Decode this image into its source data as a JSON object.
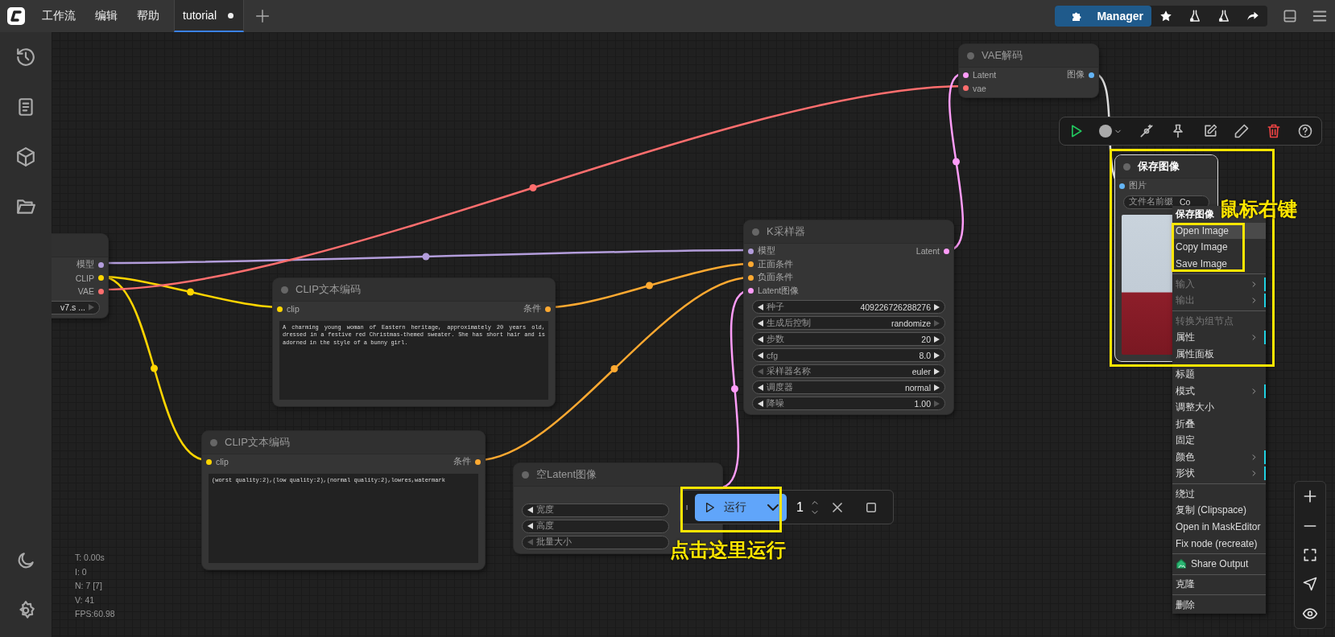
{
  "menus": [
    {
      "label": "工作流"
    },
    {
      "label": "编辑"
    },
    {
      "label": "帮助"
    }
  ],
  "tabs": [
    {
      "label": "tutorial",
      "selected": true,
      "unsaved": true
    }
  ],
  "manager": {
    "label": "Manager"
  },
  "nodes": [
    {
      "kind": "checkpoint",
      "outputs": [
        {
          "label": "模型",
          "color": "#b39ddb"
        },
        {
          "label": "CLIP",
          "color": "#ffd500"
        },
        {
          "label": "VAE",
          "color": "#ff6e6e"
        }
      ],
      "widgets": [
        {
          "kind": "combo",
          "value": "v7.s ...",
          "right_disabled": true
        }
      ]
    },
    {
      "kind": "clip_text",
      "title": "CLIP文本编码",
      "inputs": [
        {
          "label": "clip",
          "color": "#ffd500"
        }
      ],
      "outputs": [
        {
          "label": "条件",
          "color": "#ffa931"
        }
      ],
      "text": "(worst quality:2),(low quality:2),(normal quality:2),lowres,watermark"
    },
    {
      "kind": "clip_text",
      "title": "CLIP文本编码",
      "inputs": [
        {
          "label": "clip",
          "color": "#ffd500"
        }
      ],
      "outputs": [
        {
          "label": "条件",
          "color": "#ffa931"
        }
      ],
      "text": "A charming young woman of Eastern heritage, approximately 20 years old, dressed in a festive red Christmas-themed sweater. She has short hair and is adorned in the style of a bunny girl."
    },
    {
      "kind": "empty_latent",
      "title": "空Latent图像",
      "widgets": [
        {
          "kind": "number",
          "label": "宽度",
          "left_disabled": false
        },
        {
          "kind": "number",
          "label": "高度",
          "left_disabled": false
        },
        {
          "kind": "number",
          "label": "批量大小",
          "left_disabled": true
        }
      ]
    },
    {
      "kind": "ksampler",
      "title": "K采样器",
      "inputs": [
        {
          "label": "模型",
          "color": "#b39ddb"
        },
        {
          "label": "正面条件",
          "color": "#ffa931"
        },
        {
          "label": "负面条件",
          "color": "#ffa931"
        },
        {
          "label": "Latent图像",
          "color": "#ff9cf9"
        }
      ],
      "outputs": [
        {
          "label": "Latent",
          "color": "#ff9cf9"
        }
      ],
      "widgets": [
        {
          "kind": "number",
          "label": "种子",
          "value": "409226726288276",
          "left_disabled": false,
          "right_disabled": false
        },
        {
          "kind": "combo",
          "label": "生成后控制",
          "value": "randomize",
          "left_disabled": false,
          "right_disabled": true
        },
        {
          "kind": "number",
          "label": "步数",
          "value": "20",
          "left_disabled": false,
          "right_disabled": false
        },
        {
          "kind": "number",
          "label": "cfg",
          "value": "8.0",
          "left_disabled": false,
          "right_disabled": false
        },
        {
          "kind": "combo",
          "label": "采样器名称",
          "value": "euler",
          "left_disabled": true,
          "right_disabled": false
        },
        {
          "kind": "combo",
          "label": "调度器",
          "value": "normal",
          "left_disabled": false,
          "right_disabled": false
        },
        {
          "kind": "number",
          "label": "降噪",
          "value": "1.00",
          "left_disabled": false,
          "right_disabled": true
        }
      ]
    },
    {
      "kind": "vae_decode",
      "title": "VAE解码",
      "inputs": [
        {
          "label": "Latent",
          "color": "#ff9cf9"
        },
        {
          "label": "vae",
          "color": "#ff6e6e"
        }
      ],
      "outputs": [
        {
          "label": "图像",
          "color": "#64b5f6"
        }
      ]
    },
    {
      "kind": "save_image",
      "title": "保存图像",
      "inputs": [
        {
          "label": "图片",
          "color": "#64b5f6"
        }
      ],
      "widgets": [
        {
          "kind": "text",
          "label": "文件名前缀",
          "value": "Co"
        }
      ]
    }
  ],
  "context_menu": [
    {
      "kind": "header",
      "label": "保存图像"
    },
    {
      "kind": "item",
      "label": "Open Image",
      "hovered": true,
      "disabled": false,
      "submenu": false
    },
    {
      "kind": "item",
      "label": "Copy Image",
      "hovered": false,
      "disabled": false,
      "submenu": false
    },
    {
      "kind": "item",
      "label": "Save Image",
      "hovered": false,
      "disabled": false,
      "submenu": false
    },
    {
      "kind": "separator"
    },
    {
      "kind": "item",
      "label": "输入",
      "hovered": false,
      "disabled": true,
      "submenu": true
    },
    {
      "kind": "item",
      "label": "输出",
      "hovered": false,
      "disabled": true,
      "submenu": true
    },
    {
      "kind": "separator"
    },
    {
      "kind": "item",
      "label": "转换为组节点",
      "hovered": false,
      "disabled": true,
      "submenu": false
    },
    {
      "kind": "item",
      "label": "属性",
      "hovered": false,
      "disabled": false,
      "submenu": true
    },
    {
      "kind": "item",
      "label": "属性面板",
      "hovered": false,
      "disabled": false,
      "submenu": false
    },
    {
      "kind": "separator"
    },
    {
      "kind": "item",
      "label": "标题",
      "hovered": false,
      "disabled": false,
      "submenu": false
    },
    {
      "kind": "item",
      "label": "模式",
      "hovered": false,
      "disabled": false,
      "submenu": true
    },
    {
      "kind": "item",
      "label": "调整大小",
      "hovered": false,
      "disabled": false,
      "submenu": false
    },
    {
      "kind": "item",
      "label": "折叠",
      "hovered": false,
      "disabled": false,
      "submenu": false
    },
    {
      "kind": "item",
      "label": "固定",
      "hovered": false,
      "disabled": false,
      "submenu": false
    },
    {
      "kind": "item",
      "label": "颜色",
      "hovered": false,
      "disabled": false,
      "submenu": true
    },
    {
      "kind": "item",
      "label": "形状",
      "hovered": false,
      "disabled": false,
      "submenu": true
    },
    {
      "kind": "separator"
    },
    {
      "kind": "item",
      "label": "绕过",
      "hovered": false,
      "disabled": false,
      "submenu": false
    },
    {
      "kind": "item",
      "label": "复制 (Clipspace)",
      "hovered": false,
      "disabled": false,
      "submenu": false
    },
    {
      "kind": "item",
      "label": "Open in MaskEditor",
      "hovered": false,
      "disabled": false,
      "submenu": false
    },
    {
      "kind": "item",
      "label": "Fix node (recreate)",
      "hovered": false,
      "disabled": false,
      "submenu": false
    },
    {
      "kind": "separator"
    },
    {
      "kind": "share",
      "label": "Share Output"
    },
    {
      "kind": "separator"
    },
    {
      "kind": "item",
      "label": "克隆",
      "hovered": false,
      "disabled": false,
      "submenu": false
    },
    {
      "kind": "separator"
    },
    {
      "kind": "item",
      "label": "删除",
      "hovered": false,
      "disabled": false,
      "submenu": false
    }
  ],
  "run_bar": {
    "label": "运行",
    "count": "1"
  },
  "stats": [
    "T: 0.00s",
    "I: 0",
    "N: 7 [7]",
    "V: 41",
    "FPS:60.98"
  ],
  "annotations": [
    {
      "text": "鼠标右键"
    },
    {
      "text": "点击这里运行"
    }
  ]
}
